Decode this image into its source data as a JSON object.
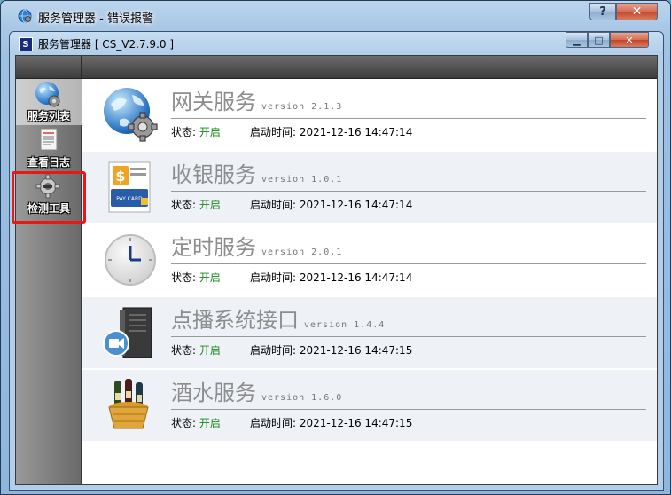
{
  "outer_window": {
    "title": "服务管理器 - 错误报警",
    "help_label": "?",
    "close_label": "✕"
  },
  "inner_window": {
    "title": "服务管理器 [ CS_V2.7.9.0 ]",
    "app_icon_text": "S",
    "min_label": "▁",
    "max_label": "□",
    "close_label": "✕"
  },
  "sidebar": {
    "items": [
      {
        "label": "服务列表",
        "icon": "globe-gear-icon",
        "active": true
      },
      {
        "label": "查看日志",
        "icon": "log-document-icon",
        "active": false
      },
      {
        "label": "检测工具",
        "icon": "gear-tool-icon",
        "active": false
      }
    ],
    "highlight_color": "#e81818"
  },
  "services": [
    {
      "name": "网关服务",
      "version": "version 2.1.3",
      "status_label": "状态:",
      "status_value": "开启",
      "time_label": "启动时间:",
      "time_value": "2021-12-16 14:47:14",
      "icon": "globe-gear-icon"
    },
    {
      "name": "收银服务",
      "version": "version 1.0.1",
      "status_label": "状态:",
      "status_value": "开启",
      "time_label": "启动时间:",
      "time_value": "2021-12-16 14:47:14",
      "icon": "pay-card-icon"
    },
    {
      "name": "定时服务",
      "version": "version 2.0.1",
      "status_label": "状态:",
      "status_value": "开启",
      "time_label": "启动时间:",
      "time_value": "2021-12-16 14:47:14",
      "icon": "clock-icon"
    },
    {
      "name": "点播系统接口",
      "version": "version 1.4.4",
      "status_label": "状态:",
      "status_value": "开启",
      "time_label": "启动时间:",
      "time_value": "2021-12-16 14:47:15",
      "icon": "server-camera-icon"
    },
    {
      "name": "酒水服务",
      "version": "version 1.6.0",
      "status_label": "状态:",
      "status_value": "开启",
      "time_label": "启动时间:",
      "time_value": "2021-12-16 14:47:15",
      "icon": "wine-basket-icon"
    }
  ],
  "pay_card_text": "PAY CARD",
  "colors": {
    "status_on": "#1a8a1a",
    "service_name": "#8d8d8d"
  }
}
